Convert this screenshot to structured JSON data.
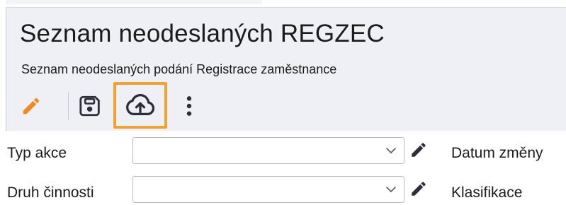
{
  "header": {
    "title": "Seznam neodeslaných REGZEC",
    "subtitle": "Seznam neodeslaných podání Registrace zaměstnance"
  },
  "toolbar": {
    "items": [
      {
        "icon": "pencil-icon",
        "color": "#f08a1c"
      },
      {
        "icon": "save-icon",
        "color": "#2b2f3a"
      },
      {
        "icon": "cloud-upload-icon",
        "color": "#2b2f3a",
        "highlight": "#f0a22e"
      },
      {
        "icon": "more-vertical-icon",
        "color": "#2b2f3a"
      }
    ]
  },
  "form": {
    "fields": [
      {
        "label": "Typ akce",
        "value": "",
        "right_label": "Datum změny"
      },
      {
        "label": "Druh činnosti",
        "value": "",
        "right_label": "Klasifikace"
      }
    ]
  },
  "colors": {
    "accent": "#f0a22e",
    "panel_bg": "#eef0f5"
  }
}
